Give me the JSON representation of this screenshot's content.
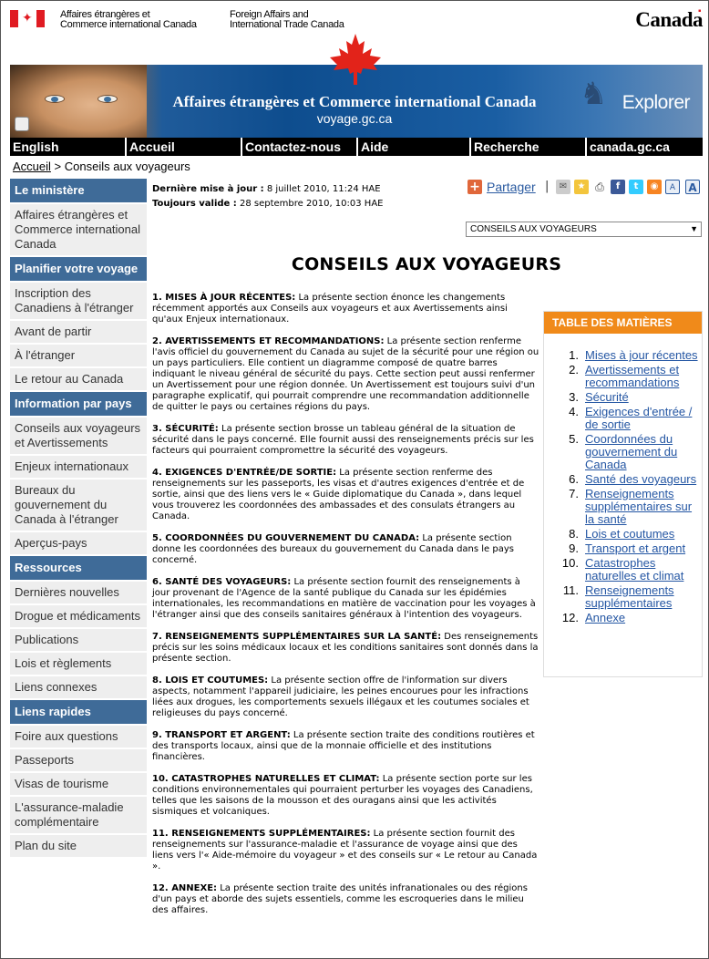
{
  "header": {
    "dept_fr_line1": "Affaires étrangères et",
    "dept_fr_line2": "Commerce international Canada",
    "dept_en_line1": "Foreign Affairs and",
    "dept_en_line2": "International Trade Canada",
    "wordmark": "Canada"
  },
  "banner": {
    "title": "Affaires étrangères et Commerce international Canada",
    "url": "voyage.gc.ca",
    "explorer": "Explorer"
  },
  "menu": {
    "items": [
      "English",
      "Accueil",
      "Contactez-nous",
      "Aide",
      "Recherche",
      "canada.gc.ca"
    ]
  },
  "breadcrumb": {
    "home": "Accueil",
    "separator": " > ",
    "current": "Conseils aux voyageurs"
  },
  "sidebar": {
    "sections": [
      {
        "heading": "Le ministère",
        "items": [
          "Affaires étrangères et Commerce international Canada"
        ]
      },
      {
        "heading": "Planifier votre voyage",
        "items": [
          "Inscription des Canadiens à l'étranger",
          "Avant de partir",
          "À l'étranger",
          "Le retour au Canada"
        ]
      },
      {
        "heading": "Information par pays",
        "items": [
          "Conseils aux voyageurs et Avertissements",
          "Enjeux internationaux",
          "Bureaux du gouvernement du Canada à l'étranger",
          "Aperçus-pays"
        ]
      },
      {
        "heading": "Ressources",
        "items": [
          "Dernières nouvelles",
          "Drogue et médicaments",
          "Publications",
          "Lois et règlements",
          "Liens connexes"
        ]
      },
      {
        "heading": "Liens rapides",
        "items": [
          "Foire aux questions",
          "Passeports",
          "Visas de tourisme",
          "L'assurance-maladie complémentaire",
          "Plan du site"
        ]
      }
    ]
  },
  "meta": {
    "updated_label": "Dernière mise à jour :",
    "updated_value": "8 juillet 2010, 11:24 HAE",
    "valid_label": "Toujours valide :",
    "valid_value": "28 septembre 2010, 10:03 HAE"
  },
  "share": {
    "label": "Partager",
    "separator": "|",
    "icons": [
      "email-icon",
      "favorite-star-icon",
      "print-icon",
      "facebook-icon",
      "twitter-icon",
      "rss-icon",
      "text-size-small-icon",
      "text-size-large-icon"
    ],
    "colors": {
      "accent": "#e0673a",
      "facebook": "#3b5998",
      "twitter": "#33ccff",
      "rss": "#f78422"
    }
  },
  "select": {
    "value": "CONSEILS AUX VOYAGEURS"
  },
  "main": {
    "title": "CONSEILS AUX VOYAGEURS",
    "paragraphs": [
      {
        "label": "1. MISES À JOUR RÉCENTES:",
        "text": " La présente section énonce les changements récemment apportés aux Conseils aux voyageurs et aux Avertissements ainsi qu'aux Enjeux internationaux."
      },
      {
        "label": "2. AVERTISSEMENTS ET RECOMMANDATIONS:",
        "text": " La présente section renferme l'avis officiel du gouvernement du Canada au sujet de la sécurité pour une région ou un pays particuliers. Elle contient un diagramme composé de quatre barres indiquant le niveau général de sécurité du pays. Cette section peut aussi renfermer un Avertissement pour une région donnée. Un Avertissement est toujours suivi d'un paragraphe explicatif, qui pourrait comprendre une recommandation additionnelle de quitter le pays ou certaines régions du pays."
      },
      {
        "label": "3. SÉCURITÉ:",
        "text": " La présente section brosse un tableau général de la situation de sécurité dans le pays concerné. Elle fournit aussi des renseignements précis sur les facteurs qui pourraient compromettre la sécurité des voyageurs."
      },
      {
        "label": "4. EXIGENCES D'ENTRÉE/DE SORTIE:",
        "text": " La présente section renferme des renseignements sur les passeports, les visas et d'autres exigences d'entrée et de sortie, ainsi que des liens vers le « Guide diplomatique du Canada », dans lequel vous trouverez les coordonnées des ambassades et des consulats étrangers au Canada."
      },
      {
        "label": "5. COORDONNÉES DU GOUVERNEMENT DU CANADA:",
        "text": " La présente section donne les coordonnées des bureaux du gouvernement du Canada dans le pays concerné."
      },
      {
        "label": "6. SANTÉ DES VOYAGEURS:",
        "text": " La présente section fournit des renseignements à jour provenant de l'Agence de la santé publique du Canada sur les épidémies internationales, les recommandations en matière de vaccination pour les voyages à l'étranger ainsi que des conseils sanitaires généraux à l'intention des voyageurs."
      },
      {
        "label": "7. RENSEIGNEMENTS SUPPLÉMENTAIRES SUR LA SANTÉ:",
        "text": " Des renseignements précis sur les soins médicaux locaux et les conditions sanitaires sont donnés dans la présente section."
      },
      {
        "label": "8. LOIS ET COUTUMES:",
        "text": " La présente section offre de l'information sur divers aspects, notamment l'appareil judiciaire, les peines encourues pour les infractions liées aux drogues, les comportements sexuels illégaux et les coutumes sociales et religieuses du pays concerné."
      },
      {
        "label": "9. TRANSPORT ET ARGENT:",
        "text": " La présente section traite des conditions routières et des transports locaux, ainsi que de la monnaie officielle et des institutions financières."
      },
      {
        "label": "10. CATASTROPHES NATURELLES ET CLIMAT:",
        "text": " La présente section porte sur les conditions environnementales qui pourraient perturber les voyages des Canadiens, telles que les saisons de la mousson et des ouragans ainsi que les activités sismiques et volcaniques."
      },
      {
        "label": "11. RENSEIGNEMENTS SUPPLÉMENTAIRES:",
        "text": " La présente section fournit des renseignements sur l'assurance-maladie et l'assurance de voyage ainsi que des liens vers l'« Aide-mémoire du voyageur » et des conseils sur « Le retour au Canada »."
      },
      {
        "label": "12. ANNEXE:",
        "text": " La présente section traite des unités infranationales ou des régions d'un pays et aborde des sujets essentiels, comme les escroqueries dans le milieu des affaires."
      }
    ]
  },
  "toc": {
    "heading": "TABLE DES MATIÈRES",
    "items": [
      {
        "n": "1.",
        "label": "Mises à jour récentes"
      },
      {
        "n": "2.",
        "label": "Avertissements et recommandations"
      },
      {
        "n": "3.",
        "label": "Sécurité"
      },
      {
        "n": "4.",
        "label": "Exigences d'entrée / de sortie"
      },
      {
        "n": "5.",
        "label": "Coordonnées du gouvernement du Canada"
      },
      {
        "n": "6.",
        "label": "Santé des voyageurs"
      },
      {
        "n": "7.",
        "label": "Renseignements supplémentaires sur la santé"
      },
      {
        "n": "8.",
        "label": "Lois et coutumes"
      },
      {
        "n": "9.",
        "label": "Transport et argent"
      },
      {
        "n": "10.",
        "label": "Catastrophes naturelles et climat"
      },
      {
        "n": "11.",
        "label": "Renseignements supplémentaires"
      },
      {
        "n": "12.",
        "label": "Annexe"
      }
    ],
    "colors": {
      "heading_bg": "#f08a1a",
      "link": "#2456a3"
    }
  },
  "colors": {
    "sidebar_heading": "#3f6b98",
    "sidebar_item_bg": "#eeeeee",
    "menu_bg": "#000000",
    "flag_red": "#e01b22"
  }
}
